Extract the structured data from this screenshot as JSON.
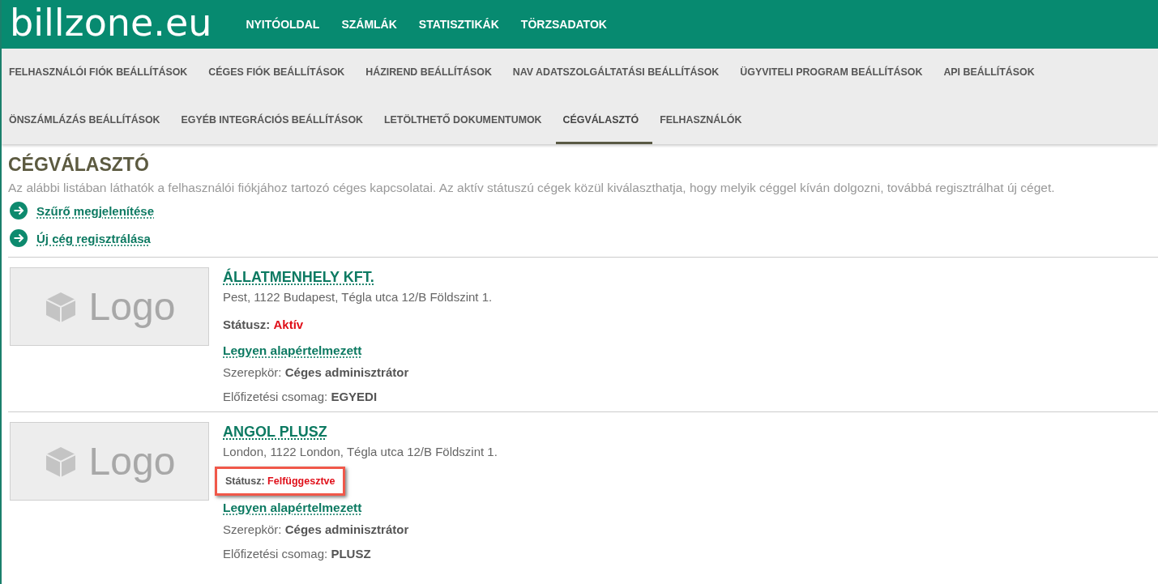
{
  "logo": "billzone.eu",
  "main_nav": [
    "NYITÓOLDAL",
    "SZÁMLÁK",
    "STATISZTIKÁK",
    "TÖRZSADATOK"
  ],
  "sub_nav": [
    {
      "label": "FELHASZNÁLÓI FIÓK BEÁLLÍTÁSOK",
      "selected": false
    },
    {
      "label": "CÉGES FIÓK BEÁLLÍTÁSOK",
      "selected": false
    },
    {
      "label": "HÁZIREND BEÁLLÍTÁSOK",
      "selected": false
    },
    {
      "label": "NAV ADATSZOLGÁLTATÁSI BEÁLLÍTÁSOK",
      "selected": false
    },
    {
      "label": "ÜGYVITELI PROGRAM BEÁLLÍTÁSOK",
      "selected": false
    },
    {
      "label": "API BEÁLLÍTÁSOK",
      "selected": false
    },
    {
      "label": "ÖNSZÁMLÁZÁS BEÁLLÍTÁSOK",
      "selected": false
    },
    {
      "label": "EGYÉB INTEGRÁCIÓS BEÁLLÍTÁSOK",
      "selected": false
    },
    {
      "label": "LETÖLTHETŐ DOKUMENTUMOK",
      "selected": false
    },
    {
      "label": "CÉGVÁLASZTÓ",
      "selected": true
    },
    {
      "label": "FELHASZNÁLÓK",
      "selected": false
    }
  ],
  "page_title": "CÉGVÁLASZTÓ",
  "description": "Az alábbi listában láthatók a felhasználói fiókjához tartozó céges kapcsolatai. Az aktív státuszú cégek közül kiválaszthatja, hogy melyik céggel kíván dolgozni, továbbá regisztrálhat új céget.",
  "actions": [
    "Szűrő megjelenítése",
    "Új cég regisztrálása"
  ],
  "companies": [
    {
      "logo_placeholder": "Logo",
      "name": "ÁLLATMENHELY KFT.",
      "address": "Pest, 1122 Budapest, Tégla utca 12/B Földszint 1.",
      "status_label": "Státusz:",
      "status": "Aktív",
      "highlighted": false,
      "default_link": "Legyen alapértelmezett",
      "role_label": "Szerepkör:",
      "role": "Céges adminisztrátor",
      "plan_label": "Előfizetési csomag:",
      "plan": "EGYEDI"
    },
    {
      "logo_placeholder": "Logo",
      "name": "ANGOL PLUSZ",
      "address": "London, 1122 London, Tégla utca 12/B Földszint 1.",
      "status_label": "Státusz:",
      "status": "Felfüggesztve",
      "highlighted": true,
      "default_link": "Legyen alapértelmezett",
      "role_label": "Szerepkör:",
      "role": "Céges adminisztrátor",
      "plan_label": "Előfizetési csomag:",
      "plan": "PLUSZ"
    }
  ]
}
